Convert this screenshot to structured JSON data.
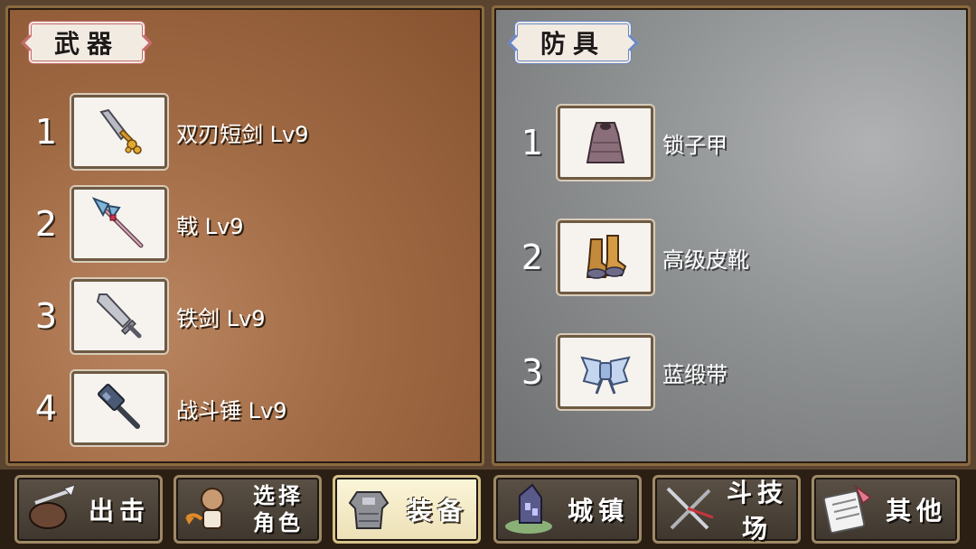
{
  "weapons": {
    "title": "武器",
    "items": [
      {
        "num": "1",
        "name": "双刃短剑 Lv9",
        "icon": "dagger-icon"
      },
      {
        "num": "2",
        "name": "戟 Lv9",
        "icon": "halberd-icon"
      },
      {
        "num": "3",
        "name": "铁剑 Lv9",
        "icon": "iron-sword-icon"
      },
      {
        "num": "4",
        "name": "战斗锤 Lv9",
        "icon": "war-hammer-icon"
      }
    ]
  },
  "armor": {
    "title": "防具",
    "items": [
      {
        "num": "1",
        "name": "锁子甲",
        "icon": "chainmail-icon"
      },
      {
        "num": "2",
        "name": "高级皮靴",
        "icon": "leather-boots-icon"
      },
      {
        "num": "3",
        "name": "蓝缎带",
        "icon": "blue-ribbon-icon"
      }
    ]
  },
  "tabs": [
    {
      "label": "出击",
      "icon": "sortie-icon",
      "active": false
    },
    {
      "label_line1": "选择",
      "label_line2": "角色",
      "icon": "character-select-icon",
      "active": false
    },
    {
      "label": "装备",
      "icon": "equipment-icon",
      "active": true
    },
    {
      "label": "城镇",
      "icon": "town-icon",
      "active": false
    },
    {
      "label": "斗技场",
      "icon": "arena-icon",
      "active": false
    },
    {
      "label": "其他",
      "icon": "misc-icon",
      "active": false
    }
  ],
  "colors": {
    "weapons_accent": "#c56a6a",
    "armor_accent": "#6a86c5",
    "active_tab": "#fbf5d8"
  }
}
